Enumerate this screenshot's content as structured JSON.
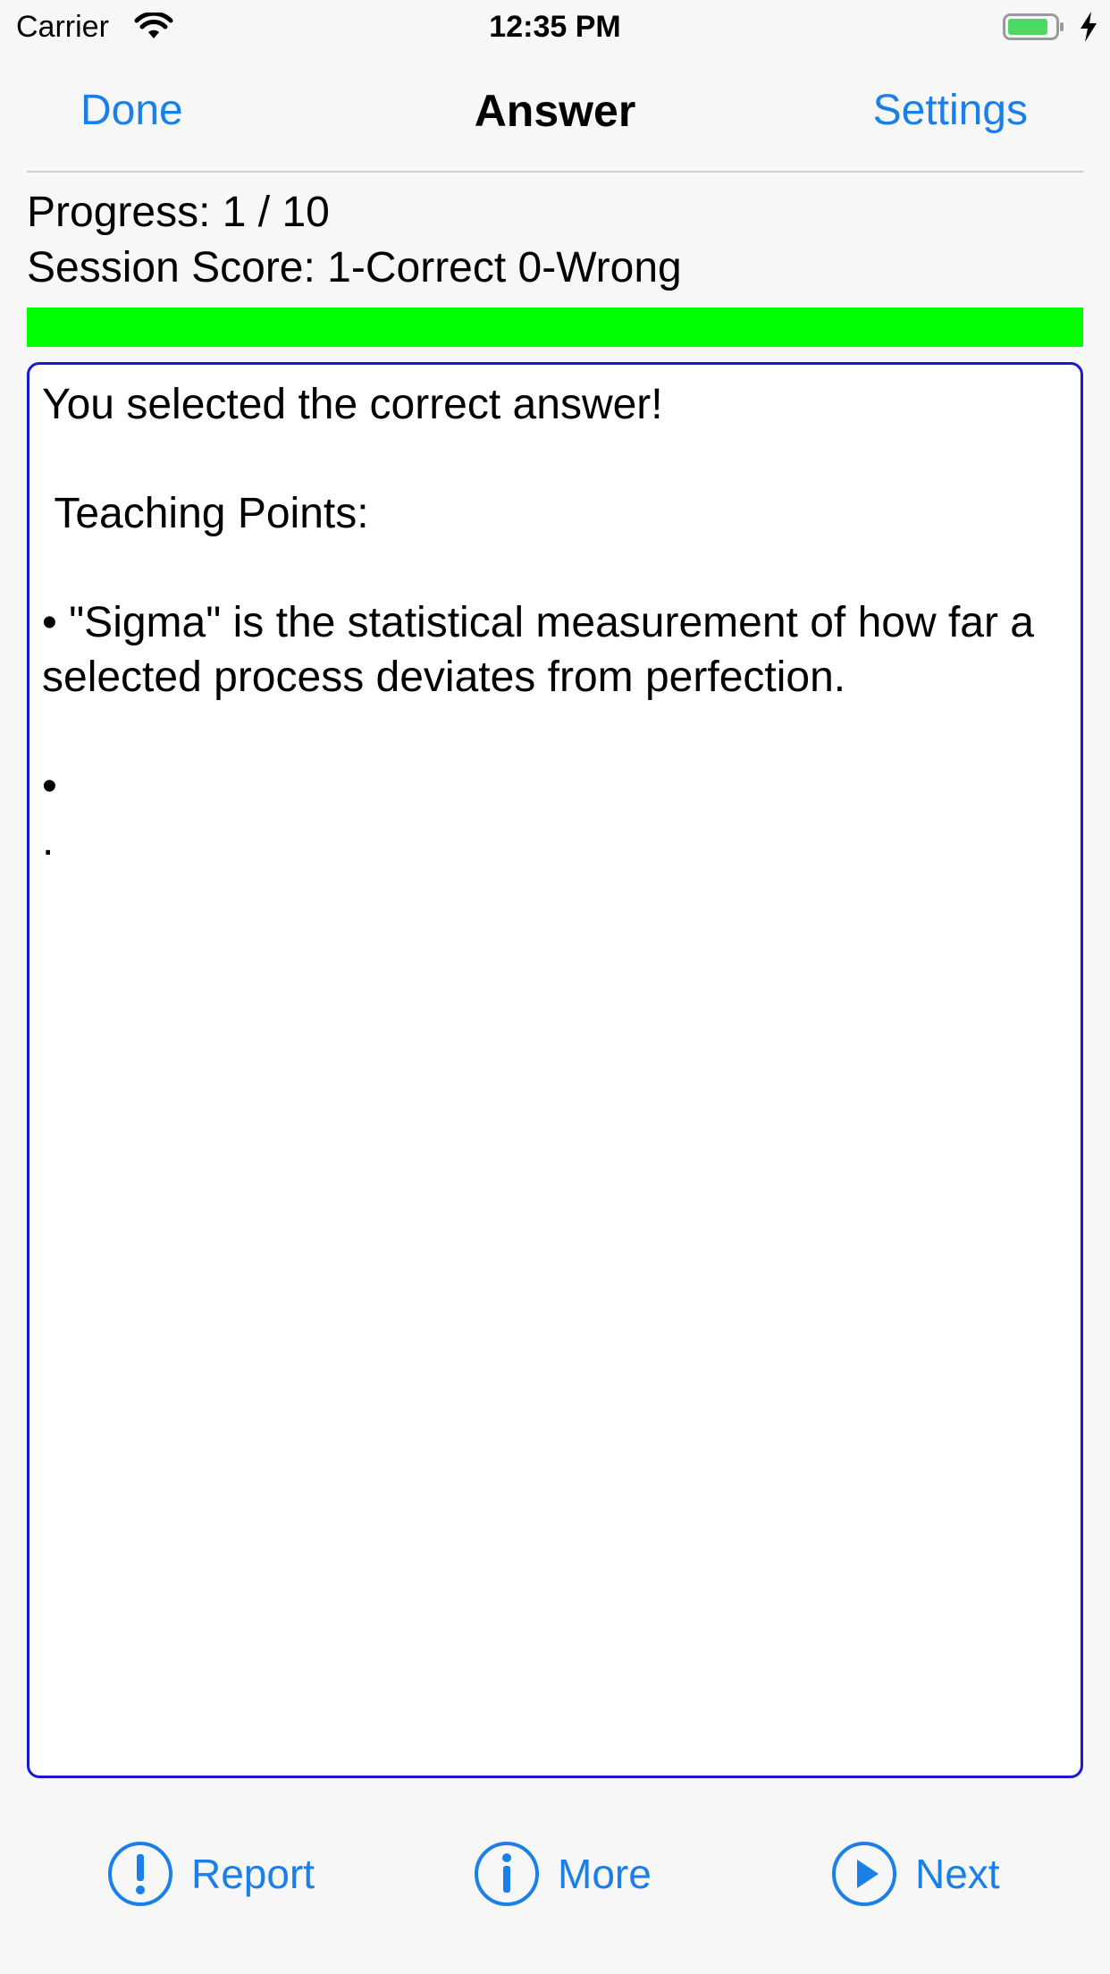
{
  "status_bar": {
    "carrier": "Carrier",
    "time": "12:35 PM",
    "icons": [
      "wifi-icon",
      "battery-icon",
      "charging-icon"
    ],
    "battery_color": "#4cd964"
  },
  "nav": {
    "done_label": "Done",
    "title": "Answer",
    "settings_label": "Settings"
  },
  "session": {
    "progress_text": "Progress: 1 / 10",
    "score_text": "Session Score: 1-Correct 0-Wrong",
    "progress_fraction": 1.0,
    "progress_color": "#00ff00"
  },
  "answer": {
    "text": "You selected the correct answer!\n\n Teaching Points:\n\n• \"Sigma\" is the statistical measurement of how far a selected process deviates from perfection.\n\n•\n."
  },
  "toolbar": {
    "report_label": "Report",
    "report_icon": "exclamation-circle-icon",
    "more_label": "More",
    "more_icon": "info-circle-icon",
    "next_label": "Next",
    "next_icon": "play-circle-icon"
  },
  "colors": {
    "accent": "#1a7fe8",
    "box_border": "#1a1acc"
  }
}
